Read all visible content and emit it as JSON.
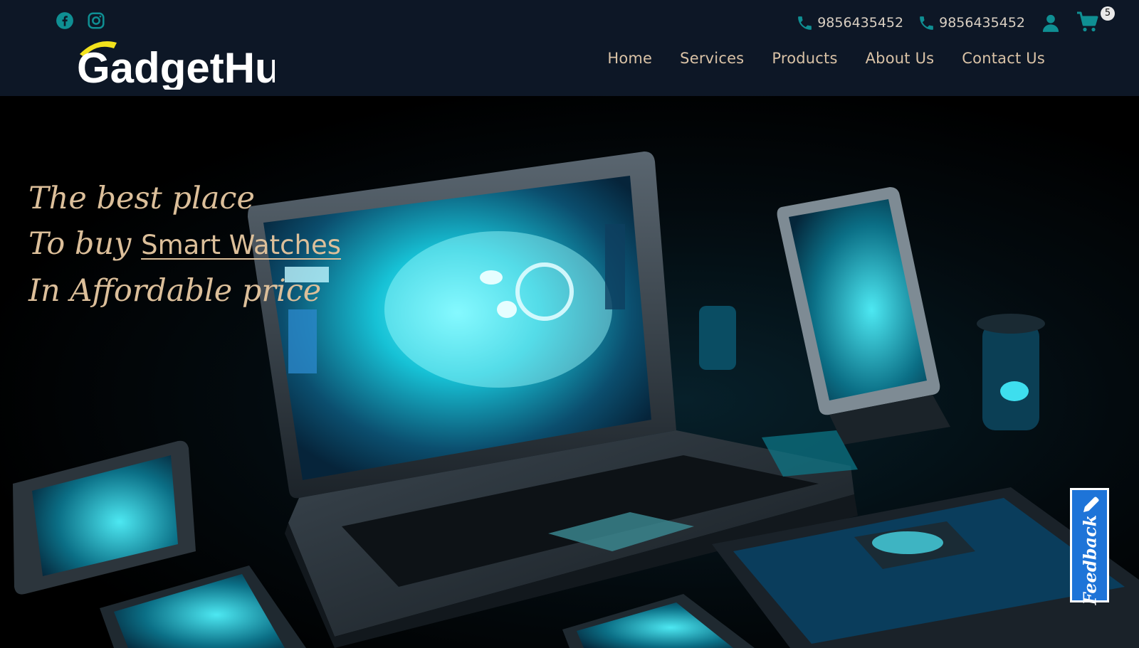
{
  "header": {
    "social": [
      {
        "icon": "facebook-icon"
      },
      {
        "icon": "instagram-icon"
      }
    ],
    "logo": {
      "brand_text": "GadgetHub"
    },
    "phones": [
      {
        "icon": "phone-icon",
        "number": "9856435452"
      },
      {
        "icon": "phone-icon",
        "number": "9856435452"
      }
    ],
    "user_icon": "user-icon",
    "cart": {
      "icon": "cart-icon",
      "count": "5"
    },
    "nav": [
      "Home",
      "Services",
      "Products",
      "About Us",
      "Contact Us"
    ]
  },
  "hero": {
    "line1": "The best place",
    "line2_prefix": "To buy ",
    "line2_highlight": "Smart Watches",
    "line3": "In Affordable price",
    "image_subject": "laptop-tablets-phones-illustration"
  },
  "feedback": {
    "label": "Feedback",
    "icon": "pencil-icon"
  },
  "colors": {
    "header_bg": "#0d1726",
    "accent_teal": "#0f8f93",
    "nav_text": "#d9c2a6",
    "tagline_text": "#dcbf9a",
    "feedback_bg": "#1e74d8",
    "logo_yellow": "#f2e21c"
  }
}
